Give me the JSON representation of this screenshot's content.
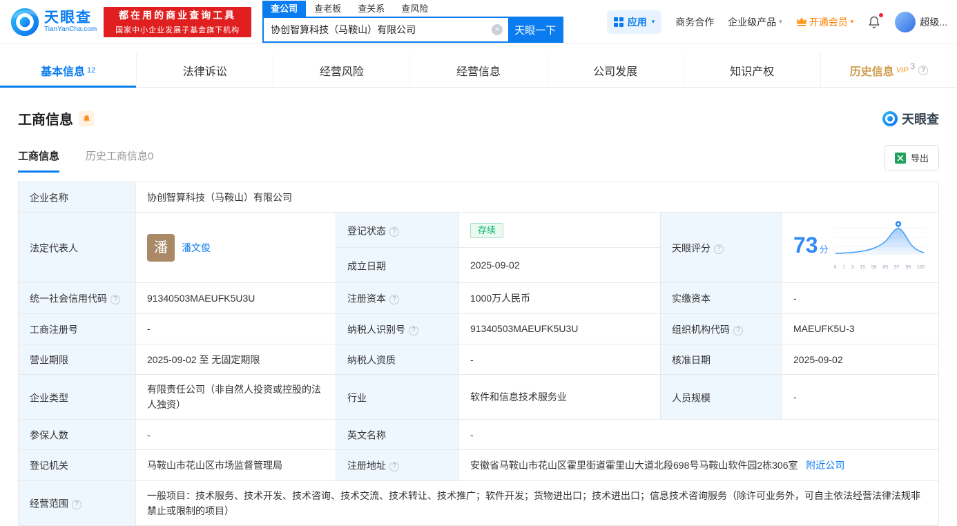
{
  "colors": {
    "brand_blue": "#0a7cf0",
    "badge_red": "#e02020",
    "vip_orange": "#ff8000",
    "status_green": "#00b365",
    "history_gold": "#cf9d4d"
  },
  "icons": {
    "clear": "×",
    "caret": "▾",
    "help": "?",
    "logo": "tianyancha-swoosh",
    "apps_grid": "grid-2x2",
    "crown": "crown",
    "bell": "bell",
    "excel": "excel-x",
    "score_pin": "map-pin"
  },
  "header": {
    "logo": {
      "cn": "天眼查",
      "en": "TianYanCha.com"
    },
    "badge": {
      "line1": "都在用的商业查询工具",
      "line2": "国家中小企业发展子基金旗下机构"
    },
    "search": {
      "tabs": [
        {
          "label": "查公司",
          "active": true
        },
        {
          "label": "查老板",
          "active": false
        },
        {
          "label": "查关系",
          "active": false
        },
        {
          "label": "查风险",
          "active": false
        }
      ],
      "value": "协创智算科技（马鞍山）有限公司",
      "button": "天眼一下"
    },
    "menu": {
      "apps": "应用",
      "coop": "商务合作",
      "enterprise": "企业级产品",
      "vip": "开通会员",
      "user": "超级..."
    }
  },
  "nav": {
    "tabs": [
      {
        "label": "基本信息",
        "count": "12",
        "active": true
      },
      {
        "label": "法律诉讼"
      },
      {
        "label": "经营风险"
      },
      {
        "label": "经营信息"
      },
      {
        "label": "公司发展"
      },
      {
        "label": "知识产权"
      },
      {
        "label": "历史信息",
        "count": "3",
        "vip": "VIP"
      }
    ]
  },
  "section": {
    "title": "工商信息",
    "watermark": "天眼查",
    "subtabs": [
      {
        "label": "工商信息",
        "active": true
      },
      {
        "label": "历史工商信息0",
        "active": false
      }
    ],
    "export": "导出"
  },
  "table": {
    "rows": {
      "company_name": {
        "label": "企业名称",
        "value": "协创智算科技（马鞍山）有限公司"
      },
      "legal_rep": {
        "label": "法定代表人",
        "avatar": "潘",
        "value": "潘文俊"
      },
      "reg_status": {
        "label": "登记状态",
        "value": "存续"
      },
      "establish_date": {
        "label": "成立日期",
        "value": "2025-09-02"
      },
      "score": {
        "label": "天眼评分",
        "value": "73",
        "unit": "分",
        "ticks": [
          "0",
          "1",
          "3",
          "15",
          "50",
          "85",
          "97",
          "99",
          "100"
        ]
      },
      "credit_code": {
        "label": "统一社会信用代码",
        "value": "91340503MAEUFK5U3U"
      },
      "reg_capital": {
        "label": "注册资本",
        "value": "1000万人民币"
      },
      "paid_capital": {
        "label": "实缴资本",
        "value": "-"
      },
      "reg_number": {
        "label": "工商注册号",
        "value": "-"
      },
      "taxpayer_id": {
        "label": "纳税人识别号",
        "value": "91340503MAEUFK5U3U"
      },
      "org_code": {
        "label": "组织机构代码",
        "value": "MAEUFK5U-3"
      },
      "business_term": {
        "label": "营业期限",
        "value": "2025-09-02 至 无固定期限"
      },
      "taxpayer_quality": {
        "label": "纳税人资质",
        "value": "-"
      },
      "approval_date": {
        "label": "核准日期",
        "value": "2025-09-02"
      },
      "company_type": {
        "label": "企业类型",
        "value": "有限责任公司（非自然人投资或控股的法人独资）"
      },
      "industry": {
        "label": "行业",
        "value": "软件和信息技术服务业"
      },
      "staff_size": {
        "label": "人员规模",
        "value": "-"
      },
      "insured_count": {
        "label": "参保人数",
        "value": "-"
      },
      "english_name": {
        "label": "英文名称",
        "value": "-"
      },
      "reg_authority": {
        "label": "登记机关",
        "value": "马鞍山市花山区市场监督管理局"
      },
      "reg_address": {
        "label": "注册地址",
        "value": "安徽省马鞍山市花山区霍里街道霍里山大道北段698号马鞍山软件园2栋306室",
        "link": "附近公司"
      },
      "business_scope": {
        "label": "经营范围",
        "value": "一般项目：技术服务、技术开发、技术咨询、技术交流、技术转让、技术推广；软件开发；货物进出口；技术进出口；信息技术咨询服务（除许可业务外，可自主依法经营法律法规非禁止或限制的项目）"
      }
    }
  }
}
